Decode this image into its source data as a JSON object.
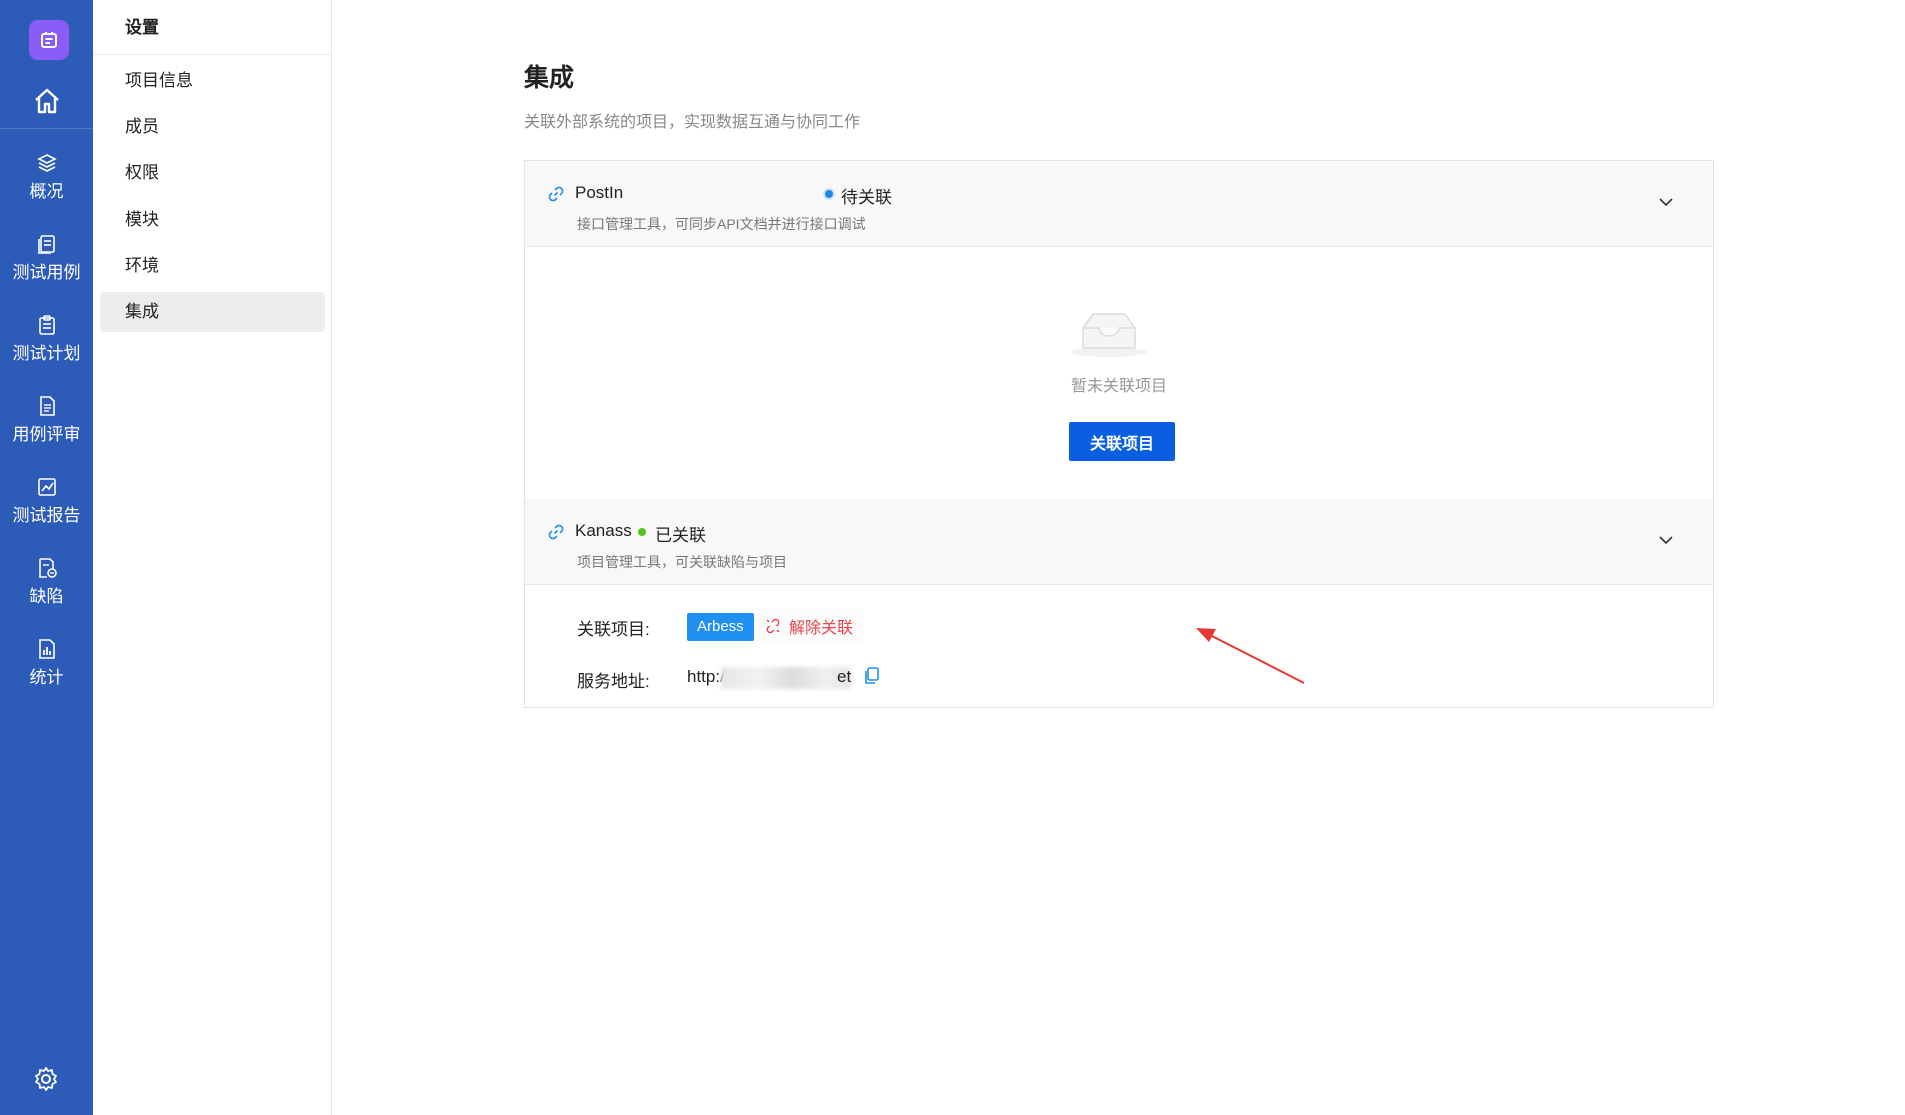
{
  "nav": {
    "items": [
      {
        "label": "概况",
        "icon": "layers-icon"
      },
      {
        "label": "测试用例",
        "icon": "book-icon"
      },
      {
        "label": "测试计划",
        "icon": "clipboard-icon"
      },
      {
        "label": "用例评审",
        "icon": "doc-list-icon"
      },
      {
        "label": "测试报告",
        "icon": "chart-icon"
      },
      {
        "label": "缺陷",
        "icon": "bug-doc-icon"
      },
      {
        "label": "统计",
        "icon": "bar-doc-icon"
      }
    ]
  },
  "submenu": {
    "title": "设置",
    "items": [
      "项目信息",
      "成员",
      "权限",
      "模块",
      "环境",
      "集成"
    ],
    "active": "集成"
  },
  "page": {
    "title": "集成",
    "description": "关联外部系统的项目，实现数据互通与协同工作"
  },
  "integrations": [
    {
      "name": "PostIn",
      "status": "待关联",
      "status_color": "#1e88e5",
      "description": "接口管理工具，可同步API文档并进行接口调试",
      "empty_text": "暂未关联项目",
      "button": "关联项目"
    },
    {
      "name": "Kanass",
      "status": "已关联",
      "status_color": "#52c41a",
      "description": "项目管理工具，可关联缺陷与项目",
      "project_label": "关联项目:",
      "project": "Arbess",
      "unlink": "解除关联",
      "url_label": "服务地址:",
      "url_prefix": "http://",
      "url_suffix": "et"
    }
  ]
}
